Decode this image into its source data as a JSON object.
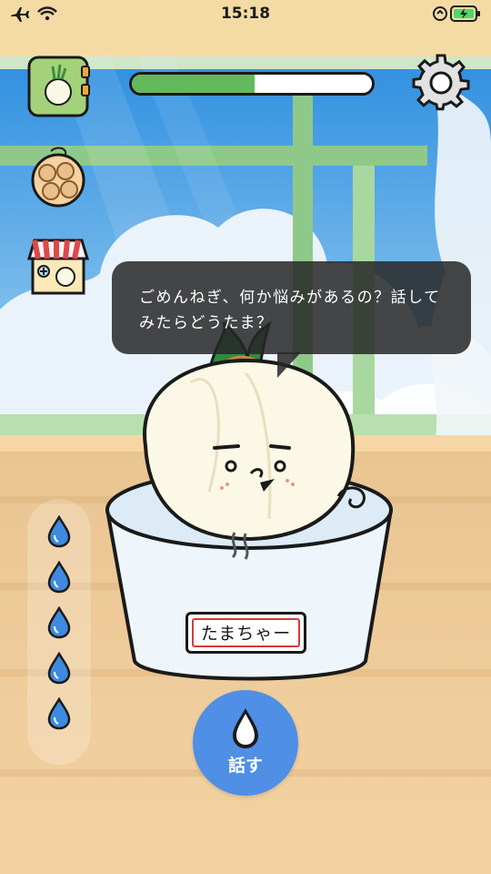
{
  "status_bar": {
    "time": "15:18"
  },
  "growth": {
    "progress": 0.51
  },
  "speech": {
    "text": "ごめんねぎ、何か悩みがあるの？話してみたらどうたま？"
  },
  "pet": {
    "name": "たまちゃー"
  },
  "water": {
    "count": 5
  },
  "actions": {
    "talk_label": "話す"
  },
  "icons": {
    "top_left": "onion-book-icon",
    "second": "onion-bag-icon",
    "third": "shop-house-icon",
    "settings": "gear-icon",
    "water": "water-drop-icon"
  },
  "colors": {
    "progress_fill": "#63b95b",
    "talk_button": "#4f8fe6",
    "water_drop": "#3d8ae0"
  }
}
